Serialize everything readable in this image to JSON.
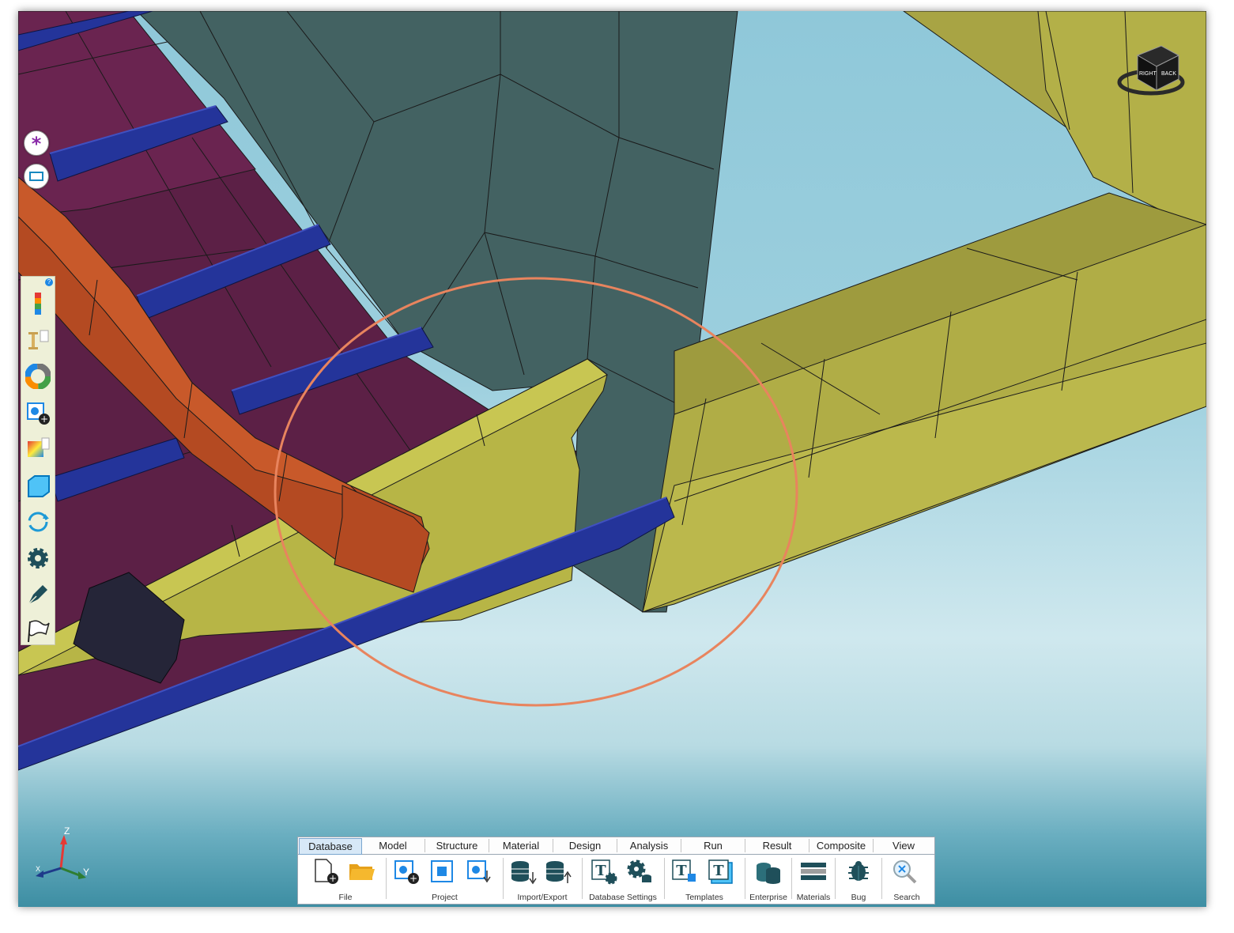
{
  "window": {
    "title": ""
  },
  "view_cube": {
    "faces": [
      "RIGHT",
      "BACK"
    ]
  },
  "floating_buttons": [
    {
      "name": "snap-star-button",
      "icon": "asterisk-icon"
    },
    {
      "name": "window-select-button",
      "icon": "rectangle-icon"
    }
  ],
  "left_toolbar": {
    "help_badge": "?",
    "items": [
      {
        "name": "contour-legend-tool",
        "icon": "color-bar-icon"
      },
      {
        "name": "beam-section-tool",
        "icon": "i-beam-icon"
      },
      {
        "name": "color-wheel-tool",
        "icon": "color-wheel-icon"
      },
      {
        "name": "add-group-tool",
        "icon": "add-group-icon"
      },
      {
        "name": "fringe-plot-tool",
        "icon": "gradient-icon"
      },
      {
        "name": "face-view-tool",
        "icon": "face-icon"
      },
      {
        "name": "rotate-tool",
        "icon": "rotate-icon"
      },
      {
        "name": "settings-tool",
        "icon": "gear-icon"
      },
      {
        "name": "pen-tool",
        "icon": "pen-icon"
      },
      {
        "name": "flag-tool",
        "icon": "flag-icon"
      }
    ]
  },
  "axes": {
    "z": "Z",
    "y": "Y",
    "x": "X"
  },
  "ribbon": {
    "tabs": [
      "Database",
      "Model",
      "Structure",
      "Material",
      "Design",
      "Analysis",
      "Run",
      "Result",
      "Composite",
      "View"
    ],
    "active_tab": "Database",
    "groups": [
      {
        "label": "File",
        "icons": [
          "new-file-icon",
          "open-folder-icon"
        ]
      },
      {
        "label": "Project",
        "icons": [
          "new-project-icon",
          "project-frame-icon",
          "project-import-icon"
        ]
      },
      {
        "label": "Import/Export",
        "icons": [
          "database-import-icon",
          "database-export-icon"
        ]
      },
      {
        "label": "Database Settings",
        "icons": [
          "template-settings-icon",
          "database-settings-icon"
        ]
      },
      {
        "label": "Templates",
        "icons": [
          "template-save-icon",
          "template-icon"
        ]
      },
      {
        "label": "Enterprise",
        "icons": [
          "enterprise-database-icon"
        ]
      },
      {
        "label": "Materials",
        "icons": [
          "materials-icon"
        ]
      },
      {
        "label": "Bug",
        "icons": [
          "bug-icon"
        ]
      },
      {
        "label": "Search",
        "icons": [
          "search-icon"
        ]
      }
    ]
  },
  "colors": {
    "deck": "#6b2248",
    "stiffener_blue": "#24349a",
    "girder_orange": "#b44a22",
    "bulkhead_teal": "#436262",
    "bracket_yellow": "#b7b546",
    "highlight_circle": "#e8845e",
    "sky": "#95cbdb"
  }
}
